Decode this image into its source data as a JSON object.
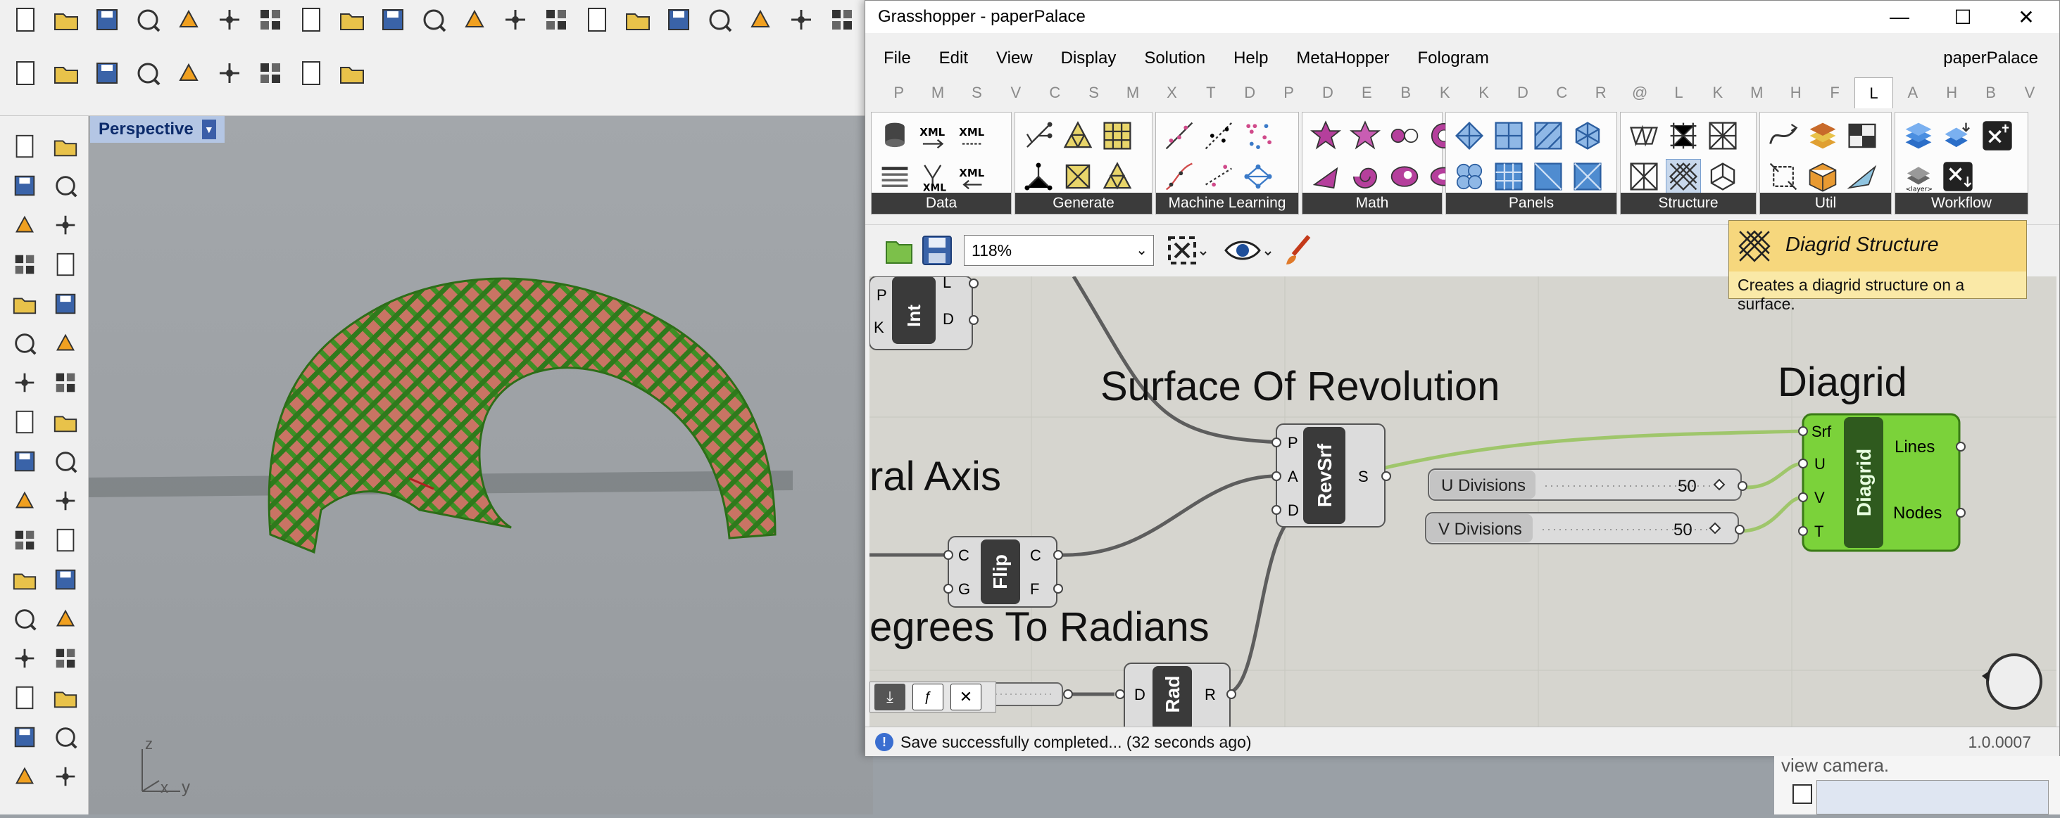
{
  "rhino": {
    "viewport_name": "Perspective",
    "axis_labels": {
      "z": "z",
      "x": "x",
      "y": "y"
    },
    "toolbar_row1": [
      "new-icon",
      "open-icon",
      "save-icon",
      "print-icon",
      "import-icon",
      "cut-icon",
      "copy-icon",
      "paste-icon",
      "undo-icon",
      "pan-icon",
      "rotate-icon",
      "zoom-icon",
      "zoom-window-icon",
      "zoom-extents-icon",
      "zoom-selected-icon",
      "rotate-view-icon",
      "four-views-icon",
      "car-icon",
      "render-icon",
      "display-icon",
      "light-icon",
      "bulb-icon"
    ],
    "toolbar_row2": [
      "sun-icon",
      "gear-sun-icon",
      "clock-icon",
      "named-view-icon",
      "named-cplane-icon",
      "layers-icon",
      "camera-icon",
      "materials-icon",
      "chart-icon"
    ],
    "sidebar_tools": [
      "select-icon",
      "point-icon",
      "polyline-icon",
      "curve-icon",
      "circle-icon",
      "ellipse-icon",
      "arc-icon",
      "rectangle-icon",
      "polygon-icon",
      "fillet-icon",
      "surface-icon",
      "extrude-icon",
      "box-icon",
      "sphere-icon",
      "cylinder-icon",
      "plane-icon",
      "boolean-icon",
      "pipe-icon",
      "trim-icon",
      "split-icon",
      "join-icon",
      "explode-icon",
      "offset-icon",
      "fillet-edge-icon",
      "text-icon",
      "dimension-icon",
      "group-icon",
      "transform-icon",
      "mesh-icon",
      "measure-icon",
      "array-icon",
      "align-icon",
      "pen-icon",
      "check-icon"
    ]
  },
  "grasshopper": {
    "title": "Grasshopper - paperPalace",
    "window_controls": {
      "minimize": "—",
      "maximize": "☐",
      "close": "✕"
    },
    "menu": [
      "File",
      "Edit",
      "View",
      "Display",
      "Solution",
      "Help",
      "MetaHopper",
      "Fologram"
    ],
    "document_name": "paperPalace",
    "tabs": [
      "P",
      "M",
      "S",
      "V",
      "C",
      "S",
      "M",
      "X",
      "T",
      "D",
      "P",
      "D",
      "E",
      "B",
      "K",
      "K",
      "D",
      "C",
      "R",
      "@",
      "L",
      "K",
      "M",
      "H",
      "F",
      "L",
      "A",
      "H",
      "B",
      "V"
    ],
    "active_tab_index": 25,
    "ribbon_panels": [
      "Data",
      "Generate",
      "Machine Learning",
      "Math",
      "Panels",
      "Structure",
      "Util",
      "Workflow"
    ],
    "zoom": "118%",
    "canvas": {
      "groups": {
        "surface_of_revolution": "Surface Of Revolution",
        "diagrid": "Diagrid",
        "axis": "ral Axis",
        "degrees": "egrees To Radians"
      },
      "components": {
        "int": {
          "name": "Int",
          "inputs": [
            "P",
            "K"
          ],
          "outputs": [
            "L",
            "D"
          ]
        },
        "revsrf": {
          "name": "RevSrf",
          "inputs": [
            "P",
            "A",
            "D"
          ],
          "outputs": [
            "S"
          ]
        },
        "flip": {
          "name": "Flip",
          "inputs": [
            "C",
            "G"
          ],
          "outputs": [
            "C",
            "F"
          ]
        },
        "rad": {
          "name": "Rad",
          "inputs": [
            "D"
          ],
          "outputs": [
            "R"
          ]
        },
        "diagrid": {
          "name": "Diagrid",
          "inputs": [
            "Srf",
            "U",
            "V",
            "T"
          ],
          "outputs": [
            "Lines",
            "Nodes"
          ]
        }
      },
      "sliders": [
        {
          "label": "U Divisions",
          "value": "50"
        },
        {
          "label": "V Divisions",
          "value": "50"
        }
      ]
    },
    "tooltip": {
      "title": "Diagrid Structure",
      "description": "Creates a diagrid structure on a surface."
    },
    "status": {
      "message": "Save successfully completed... (32 seconds ago)",
      "version": "1.0.0007"
    }
  },
  "side_panel": {
    "text": "view camera."
  },
  "colors": {
    "gh_canvas": "#d6d5cf",
    "component_green": "#7bd23a",
    "wire_green": "#9fc66b",
    "structure_green": "#3d8a22",
    "structure_red": "#c96a5b"
  }
}
